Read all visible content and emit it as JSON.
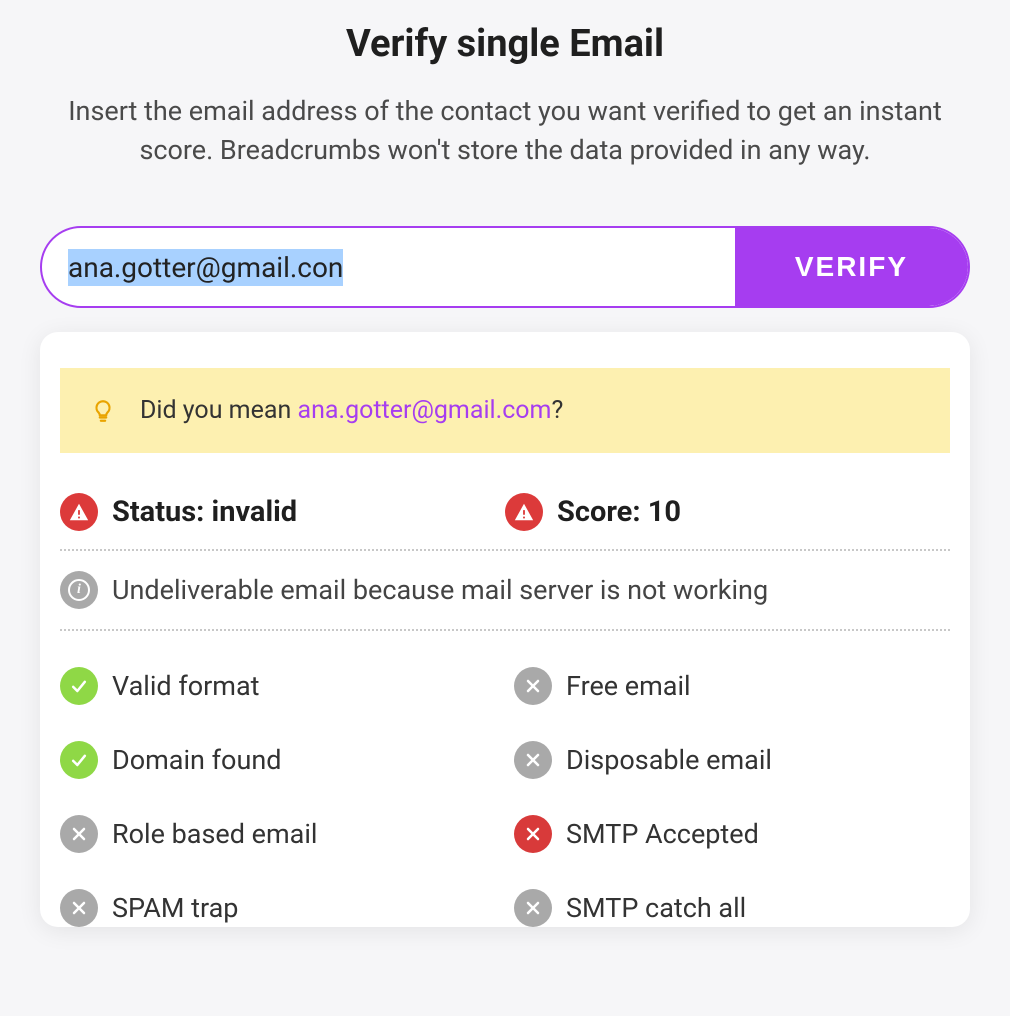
{
  "title": "Verify single Email",
  "subtitle": "Insert the email address of the contact you want verified to get an instant score. Breadcrumbs won't store the data provided in any way.",
  "input": {
    "email_value": "ana.gotter@gmail.con",
    "verify_label": "VERIFY"
  },
  "hint": {
    "prefix": "Did you mean ",
    "suggested_email": "ana.gotter@gmail.com",
    "suffix": "?"
  },
  "result": {
    "status_label": "Status: invalid",
    "score_label": "Score: 10",
    "reason": "Undeliverable email because mail server is not working",
    "checks": [
      {
        "label": "Valid format",
        "state": "pass"
      },
      {
        "label": "Free email",
        "state": "neutral"
      },
      {
        "label": "Domain found",
        "state": "pass"
      },
      {
        "label": "Disposable email",
        "state": "neutral"
      },
      {
        "label": "Role based email",
        "state": "neutral"
      },
      {
        "label": "SMTP Accepted",
        "state": "fail"
      },
      {
        "label": "SPAM trap",
        "state": "neutral"
      },
      {
        "label": "SMTP catch all",
        "state": "neutral"
      }
    ]
  },
  "colors": {
    "accent": "#a63df0",
    "pass": "#8fd846",
    "fail": "#d83a3a",
    "neutral": "#a9a9a9",
    "alert": "#dc3a3a",
    "hint_bg": "#fdf0b0"
  }
}
